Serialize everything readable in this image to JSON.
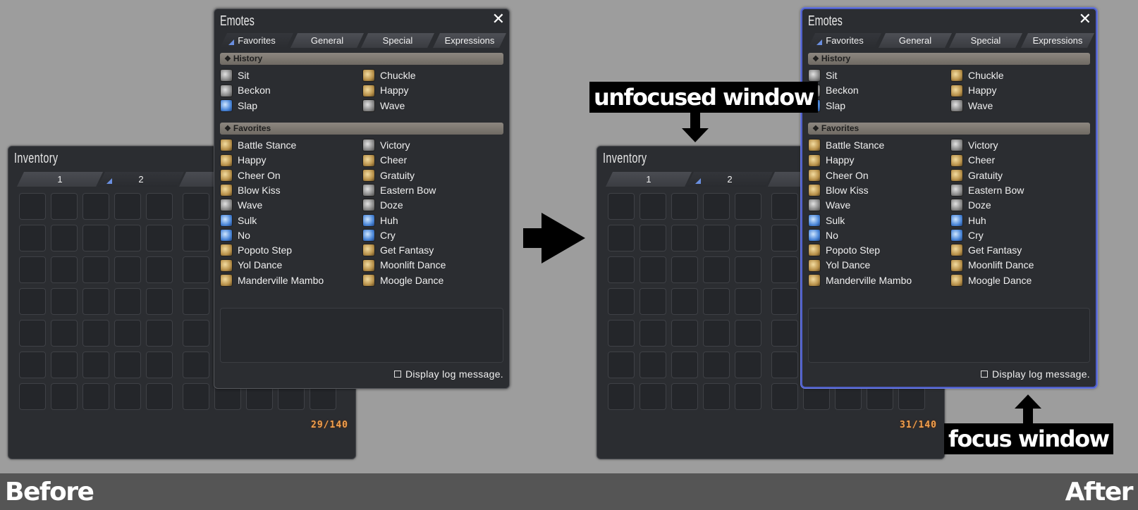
{
  "before": {
    "inventory": {
      "title": "Inventory",
      "tabs": [
        {
          "label": "1"
        },
        {
          "label": "2"
        },
        {
          "label": ""
        }
      ],
      "active_tab": "2",
      "count": "29/140"
    },
    "emotes": {
      "title": "Emotes",
      "close_glyph": "✕",
      "tabs": [
        {
          "label": "Favorites"
        },
        {
          "label": "General"
        },
        {
          "label": "Special"
        },
        {
          "label": "Expressions"
        }
      ],
      "active_tab": "Favorites",
      "history_label": "History",
      "favorites_label": "Favorites",
      "section_glyph": "❖",
      "history_items": [
        {
          "label": "Sit",
          "icon": "gray"
        },
        {
          "label": "Chuckle",
          "icon": "gold"
        },
        {
          "label": "Beckon",
          "icon": "gray"
        },
        {
          "label": "Happy",
          "icon": "gold"
        },
        {
          "label": "Slap",
          "icon": "blue"
        },
        {
          "label": "Wave",
          "icon": "gray"
        }
      ],
      "favorite_items": [
        {
          "label": "Battle Stance",
          "icon": "gold"
        },
        {
          "label": "Victory",
          "icon": "gray"
        },
        {
          "label": "Happy",
          "icon": "gold"
        },
        {
          "label": "Cheer",
          "icon": "gold"
        },
        {
          "label": "Cheer On",
          "icon": "gold"
        },
        {
          "label": "Gratuity",
          "icon": "gold"
        },
        {
          "label": "Blow Kiss",
          "icon": "gold"
        },
        {
          "label": "Eastern Bow",
          "icon": "gray"
        },
        {
          "label": "Wave",
          "icon": "gray"
        },
        {
          "label": "Doze",
          "icon": "gray"
        },
        {
          "label": "Sulk",
          "icon": "blue"
        },
        {
          "label": "Huh",
          "icon": "blue"
        },
        {
          "label": "No",
          "icon": "blue"
        },
        {
          "label": "Cry",
          "icon": "blue"
        },
        {
          "label": "Popoto Step",
          "icon": "gold"
        },
        {
          "label": "Get Fantasy",
          "icon": "gold"
        },
        {
          "label": "Yol Dance",
          "icon": "gold"
        },
        {
          "label": "Moonlift Dance",
          "icon": "gold"
        },
        {
          "label": "Manderville Mambo",
          "icon": "gold"
        },
        {
          "label": "Moogle Dance",
          "icon": "gold"
        }
      ],
      "log_label": "Display log message."
    }
  },
  "after": {
    "inventory": {
      "title": "Inventory",
      "tabs": [
        {
          "label": "1"
        },
        {
          "label": "2"
        },
        {
          "label": ""
        }
      ],
      "active_tab": "2",
      "count": "31/140"
    },
    "emotes": {
      "title": "Emotes",
      "close_glyph": "✕",
      "tabs": [
        {
          "label": "Favorites"
        },
        {
          "label": "General"
        },
        {
          "label": "Special"
        },
        {
          "label": "Expressions"
        }
      ],
      "active_tab": "Favorites",
      "history_label": "History",
      "favorites_label": "Favorites",
      "section_glyph": "❖",
      "history_items": [
        {
          "label": "Sit",
          "icon": "gray"
        },
        {
          "label": "Chuckle",
          "icon": "gold"
        },
        {
          "label": "Beckon",
          "icon": "gray"
        },
        {
          "label": "Happy",
          "icon": "gold"
        },
        {
          "label": "Slap",
          "icon": "blue"
        },
        {
          "label": "Wave",
          "icon": "gray"
        }
      ],
      "favorite_items": [
        {
          "label": "Battle Stance",
          "icon": "gold"
        },
        {
          "label": "Victory",
          "icon": "gray"
        },
        {
          "label": "Happy",
          "icon": "gold"
        },
        {
          "label": "Cheer",
          "icon": "gold"
        },
        {
          "label": "Cheer On",
          "icon": "gold"
        },
        {
          "label": "Gratuity",
          "icon": "gold"
        },
        {
          "label": "Blow Kiss",
          "icon": "gold"
        },
        {
          "label": "Eastern Bow",
          "icon": "gray"
        },
        {
          "label": "Wave",
          "icon": "gray"
        },
        {
          "label": "Doze",
          "icon": "gray"
        },
        {
          "label": "Sulk",
          "icon": "blue"
        },
        {
          "label": "Huh",
          "icon": "blue"
        },
        {
          "label": "No",
          "icon": "blue"
        },
        {
          "label": "Cry",
          "icon": "blue"
        },
        {
          "label": "Popoto Step",
          "icon": "gold"
        },
        {
          "label": "Get Fantasy",
          "icon": "gold"
        },
        {
          "label": "Yol Dance",
          "icon": "gold"
        },
        {
          "label": "Moonlift Dance",
          "icon": "gold"
        },
        {
          "label": "Manderville Mambo",
          "icon": "gold"
        },
        {
          "label": "Moogle Dance",
          "icon": "gold"
        }
      ],
      "log_label": "Display log message.",
      "focused": true
    }
  },
  "annotations": {
    "unfocused_label": "unfocused window",
    "focus_label": "focus window",
    "before_label": "Before",
    "after_label": "After"
  },
  "colors": {
    "background": "#9d9d9d",
    "window": "#2b2d31",
    "focus_border": "#4f5fc9",
    "count_text": "#f0a050",
    "tab_marker": "#6a8fe0"
  }
}
